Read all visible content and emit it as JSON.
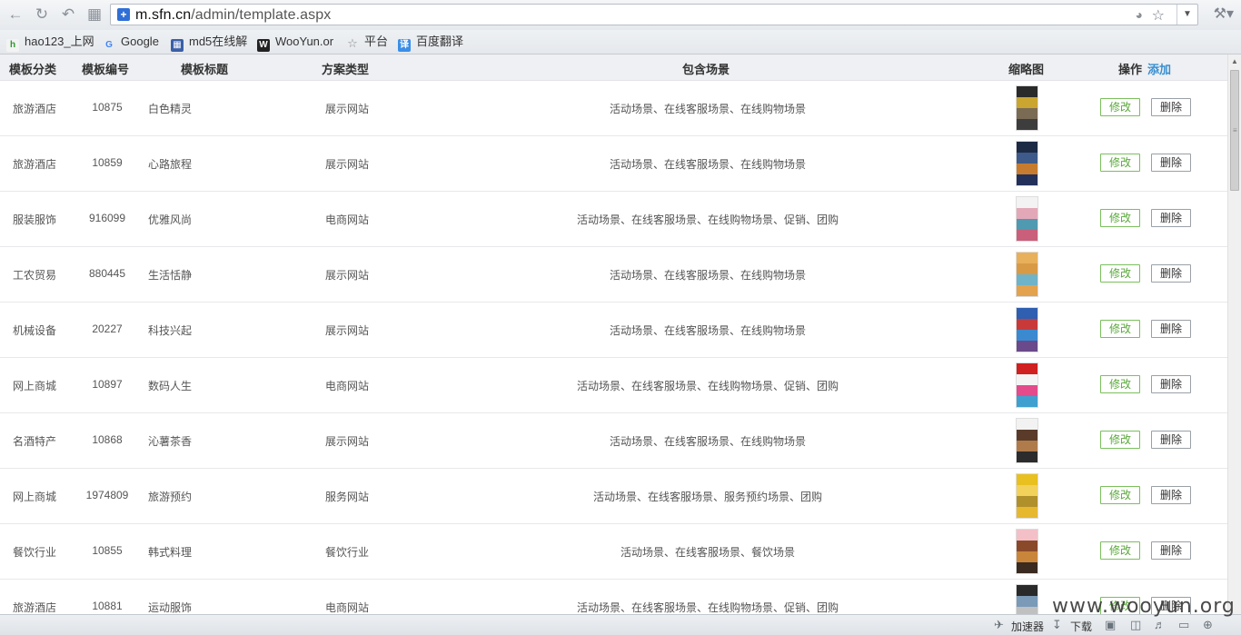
{
  "browser": {
    "url_host": "m.sfn.cn",
    "url_path": "/admin/template.aspx",
    "bookmarks": [
      {
        "label": "hao123_上网"
      },
      {
        "label": "Google"
      },
      {
        "label": "md5在线解"
      },
      {
        "label": "WooYun.or"
      },
      {
        "label": "平台"
      },
      {
        "label": "百度翻译"
      }
    ],
    "status": {
      "accelerator": "加速器",
      "download": "下载"
    },
    "watermark": "www.wooyun.org"
  },
  "table": {
    "headers": {
      "category": "模板分类",
      "id": "模板编号",
      "title": "模板标题",
      "type": "方案类型",
      "scenes": "包含场景",
      "thumbnail": "缩略图",
      "ops": "操作",
      "add": "添加"
    },
    "edit_label": "修改",
    "delete_label": "删除",
    "rows": [
      {
        "category": "旅游酒店",
        "id": "10875",
        "title": "白色精灵",
        "type": "展示网站",
        "scenes": "活动场景、在线客服场景、在线购物场景",
        "colors": [
          "#2a2a2a",
          "#caa52f",
          "#7a6b55",
          "#3d3d3d"
        ]
      },
      {
        "category": "旅游酒店",
        "id": "10859",
        "title": "心路旅程",
        "type": "展示网站",
        "scenes": "活动场景、在线客服场景、在线购物场景",
        "colors": [
          "#1c2a44",
          "#3d5a8a",
          "#c77b2e",
          "#22305a"
        ]
      },
      {
        "category": "服装服饰",
        "id": "916099",
        "title": "优雅风尚",
        "type": "电商网站",
        "scenes": "活动场景、在线客服场景、在线购物场景、促销、团购",
        "colors": [
          "#f3f3f3",
          "#e3a8b8",
          "#4f9ab0",
          "#c95f7a"
        ]
      },
      {
        "category": "工农贸易",
        "id": "880445",
        "title": "生活恬静",
        "type": "展示网站",
        "scenes": "活动场景、在线客服场景、在线购物场景",
        "colors": [
          "#e8b05a",
          "#d99a45",
          "#6fb3c9",
          "#e3a24d"
        ]
      },
      {
        "category": "机械设备",
        "id": "20227",
        "title": "科技兴起",
        "type": "展示网站",
        "scenes": "活动场景、在线客服场景、在线购物场景",
        "colors": [
          "#2f5fb0",
          "#c83a3a",
          "#3b8ad0",
          "#6a4a8a"
        ]
      },
      {
        "category": "网上商城",
        "id": "10897",
        "title": "数码人生",
        "type": "电商网站",
        "scenes": "活动场景、在线客服场景、在线购物场景、促销、团购",
        "colors": [
          "#d02020",
          "#f4f4f4",
          "#e44b8a",
          "#3fa0d0"
        ]
      },
      {
        "category": "名酒特产",
        "id": "10868",
        "title": "沁薯茶香",
        "type": "展示网站",
        "scenes": "活动场景、在线客服场景、在线购物场景",
        "colors": [
          "#f2f2f2",
          "#5a3b2a",
          "#b07b4a",
          "#2c2c2c"
        ]
      },
      {
        "category": "网上商城",
        "id": "1974809",
        "title": "旅游预约",
        "type": "服务网站",
        "scenes": "活动场景、在线客服场景、服务预约场景、团购",
        "colors": [
          "#e8c020",
          "#f2d25a",
          "#b0902a",
          "#e6b830"
        ]
      },
      {
        "category": "餐饮行业",
        "id": "10855",
        "title": "韩式料理",
        "type": "餐饮行业",
        "scenes": "活动场景、在线客服场景、餐饮场景",
        "colors": [
          "#f3c0c8",
          "#8a4a2a",
          "#c9863a",
          "#3a2a20"
        ]
      },
      {
        "category": "旅游酒店",
        "id": "10881",
        "title": "运动服饰",
        "type": "电商网站",
        "scenes": "活动场景、在线客服场景、在线购物场景、促销、团购",
        "colors": [
          "#2a2a2a",
          "#7a9ab8",
          "#c0c0c0",
          "#404040"
        ]
      }
    ]
  }
}
